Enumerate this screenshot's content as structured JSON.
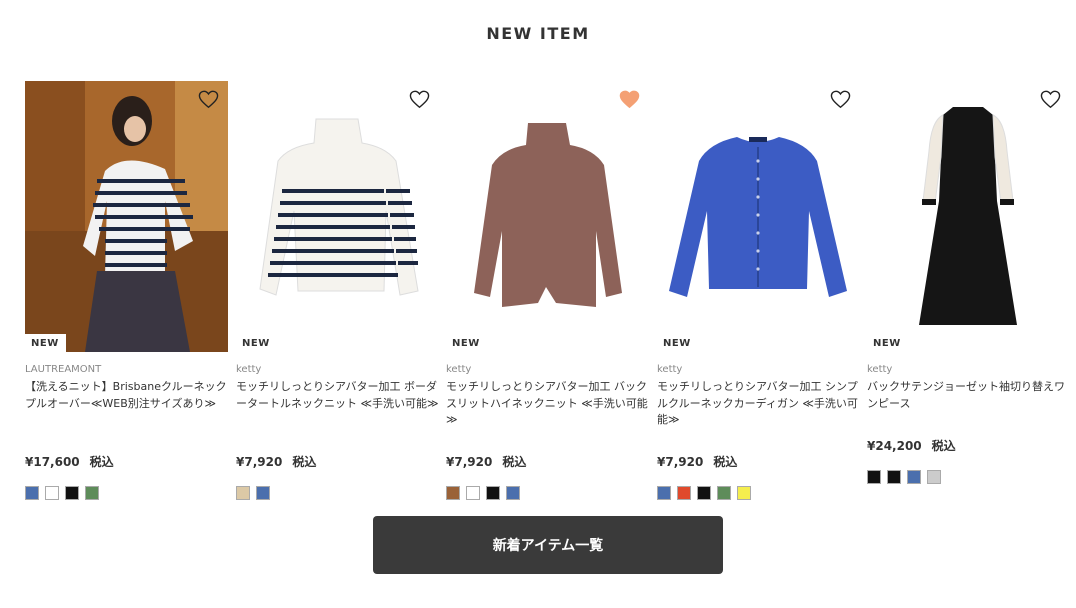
{
  "section": {
    "title": "NEW ITEM"
  },
  "products": [
    {
      "badge": "NEW",
      "brand": "LAUTREAMONT",
      "name": "【洗えるニット】Brisbaneクルーネックプルオーバー≪WEB別注サイズあり≫",
      "price": "¥17,600",
      "tax": "税込",
      "favorited": false,
      "colors": [
        "#4b6fad",
        "#ffffff",
        "#111111",
        "#5e8c5a"
      ]
    },
    {
      "badge": "NEW",
      "brand": "ketty",
      "name": "モッチリしっとりシアバター加工 ボーダータートルネックニット ≪手洗い可能≫",
      "price": "¥7,920",
      "tax": "税込",
      "favorited": false,
      "colors": [
        "#dcc9a6",
        "#4b6fad"
      ]
    },
    {
      "badge": "NEW",
      "brand": "ketty",
      "name": "モッチリしっとりシアバター加工 バックスリットハイネックニット ≪手洗い可能≫",
      "price": "¥7,920",
      "tax": "税込",
      "favorited": true,
      "colors": [
        "#9a6238",
        "#ffffff",
        "#111111",
        "#4b6fad"
      ]
    },
    {
      "badge": "NEW",
      "brand": "ketty",
      "name": "モッチリしっとりシアバター加工 シンプルクルーネックカーディガン ≪手洗い可能≫",
      "price": "¥7,920",
      "tax": "税込",
      "favorited": false,
      "colors": [
        "#4b6fad",
        "#e04a2c",
        "#111111",
        "#5e8c5a",
        "#f5ee4e"
      ]
    },
    {
      "badge": "NEW",
      "brand": "ketty",
      "name": "バックサテンジョーゼット袖切り替えワンピース",
      "price": "¥24,200",
      "tax": "税込",
      "favorited": false,
      "colors": [
        "#111111",
        "#111111",
        "#4b6fad",
        "#cccccc"
      ]
    }
  ],
  "more_button": {
    "label": "新着アイテム一覧"
  },
  "icons": {
    "favorite": "heart-icon"
  },
  "accent": {
    "favorite_active": "#f4a074"
  }
}
